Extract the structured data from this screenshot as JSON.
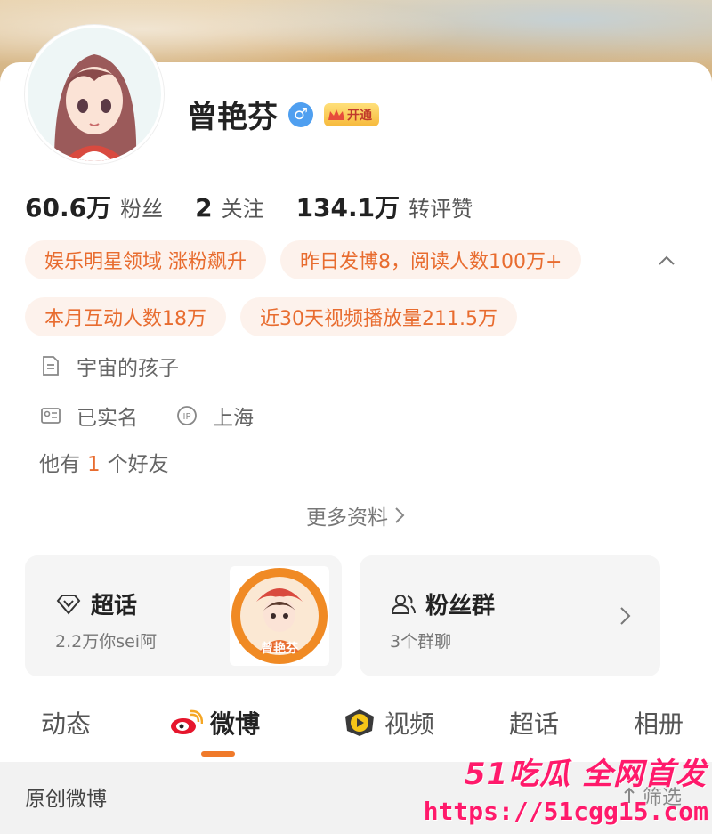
{
  "profile": {
    "name": "曾艳芬",
    "gender_symbol": "♂",
    "vip_label": "开通"
  },
  "stats": [
    {
      "value": "60.6万",
      "label": "粉丝"
    },
    {
      "value": "2",
      "label": "关注"
    },
    {
      "value": "134.1万",
      "label": "转评赞"
    }
  ],
  "tags": {
    "row1": [
      "娱乐明星领域 涨粉飙升",
      "昨日发博8，阅读人数100万+"
    ],
    "row2": [
      "本月互动人数18万",
      "近30天视频播放量211.5万"
    ]
  },
  "info": {
    "bio": "宇宙的孩子",
    "verified": "已实名",
    "ip_location": "上海",
    "friends_prefix": "他有",
    "friends_count": "1",
    "friends_suffix": "个好友"
  },
  "more_label": "更多资料",
  "cards": {
    "supertopic": {
      "title": "超话",
      "sub": "2.2万你sei阿",
      "image_caption": "曾艳芬"
    },
    "fangroup": {
      "title": "粉丝群",
      "sub": "3个群聊"
    }
  },
  "tabs": [
    "动态",
    "微博",
    "视频",
    "超话",
    "相册"
  ],
  "subbar": {
    "title": "原创微博",
    "filter": "筛选"
  },
  "watermark": {
    "line1": "51吃瓜 全网首发",
    "line2": "https://51cgg15.com"
  },
  "colors": {
    "accent": "#e86c2f",
    "tag_bg": "#fdf2ec",
    "gender": "#4f9ff0",
    "watermark": "#ff1a6b"
  }
}
